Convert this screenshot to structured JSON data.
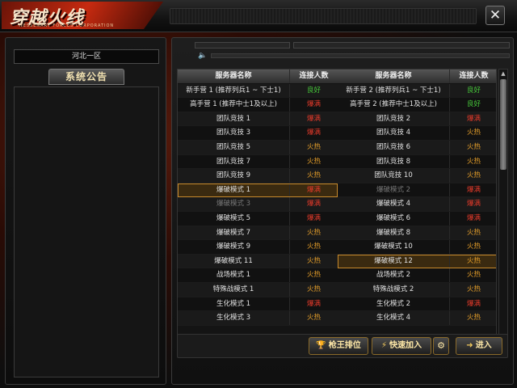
{
  "header": {
    "logo_text": "穿越火线",
    "logo_subtext": "NESSENARY FORCES CORPORATION",
    "close_label": "✕"
  },
  "left_panel": {
    "server_name": "河北一区",
    "notice_title": "系统公告"
  },
  "server_list": {
    "headers": {
      "name": "服务器名称",
      "status": "连接人数"
    },
    "left_rows": [
      {
        "name": "新手营 1 (推荐列兵1 ~ 下士1)",
        "status": "良好",
        "state": "good"
      },
      {
        "name": "高手营 1 (推荐中士1及以上)",
        "status": "爆满",
        "state": "full"
      },
      {
        "name": "团队竞技 1",
        "status": "爆满",
        "state": "full"
      },
      {
        "name": "团队竞技 3",
        "status": "爆满",
        "state": "full"
      },
      {
        "name": "团队竞技 5",
        "status": "火热",
        "state": "hot"
      },
      {
        "name": "团队竞技 7",
        "status": "火热",
        "state": "hot"
      },
      {
        "name": "团队竞技 9",
        "status": "火热",
        "state": "hot"
      },
      {
        "name": "爆破模式 1",
        "status": "爆满",
        "state": "full",
        "selected": true
      },
      {
        "name": "爆破模式 3",
        "status": "爆满",
        "state": "full",
        "dim": true
      },
      {
        "name": "爆破模式 5",
        "status": "爆满",
        "state": "full"
      },
      {
        "name": "爆破模式 7",
        "status": "火热",
        "state": "hot"
      },
      {
        "name": "爆破模式 9",
        "status": "火热",
        "state": "hot"
      },
      {
        "name": "爆破模式 11",
        "status": "火热",
        "state": "hot"
      },
      {
        "name": "战场模式 1",
        "status": "火热",
        "state": "hot"
      },
      {
        "name": "特殊战模式 1",
        "status": "火热",
        "state": "hot"
      },
      {
        "name": "生化模式 1",
        "status": "爆满",
        "state": "full"
      },
      {
        "name": "生化模式 3",
        "status": "火热",
        "state": "hot"
      }
    ],
    "right_rows": [
      {
        "name": "新手营 2 (推荐列兵1 ~ 下士1)",
        "status": "良好",
        "state": "good"
      },
      {
        "name": "高手营 2 (推荐中士1及以上)",
        "status": "良好",
        "state": "good"
      },
      {
        "name": "团队竞技 2",
        "status": "爆满",
        "state": "full"
      },
      {
        "name": "团队竞技 4",
        "status": "火热",
        "state": "hot"
      },
      {
        "name": "团队竞技 6",
        "status": "火热",
        "state": "hot"
      },
      {
        "name": "团队竞技 8",
        "status": "火热",
        "state": "hot"
      },
      {
        "name": "团队竞技 10",
        "status": "火热",
        "state": "hot"
      },
      {
        "name": "爆破模式 2",
        "status": "爆满",
        "state": "full",
        "dim": true
      },
      {
        "name": "爆破模式 4",
        "status": "爆满",
        "state": "full"
      },
      {
        "name": "爆破模式 6",
        "status": "爆满",
        "state": "full"
      },
      {
        "name": "爆破模式 8",
        "status": "火热",
        "state": "hot"
      },
      {
        "name": "爆破模式 10",
        "status": "火热",
        "state": "hot"
      },
      {
        "name": "爆破模式 12",
        "status": "火热",
        "state": "hot",
        "selected": true
      },
      {
        "name": "战场模式 2",
        "status": "火热",
        "state": "hot"
      },
      {
        "name": "特殊战模式 2",
        "status": "火热",
        "state": "hot"
      },
      {
        "name": "生化模式 2",
        "status": "爆满",
        "state": "full"
      },
      {
        "name": "生化模式 4",
        "status": "火热",
        "state": "hot"
      }
    ]
  },
  "buttons": {
    "rank_label": "枪王排位",
    "quick_label": "快速加入",
    "enter_label": "进入"
  },
  "icons": {
    "trophy": "trophy-icon",
    "lightning": "lightning-icon",
    "gear": "gear-icon",
    "arrow": "arrow-right-icon",
    "speaker": "speaker-icon"
  },
  "colors": {
    "good": "#46c63a",
    "full": "#e63a2a",
    "hot": "#e8a02a",
    "button_text": "#ffe9a8"
  }
}
